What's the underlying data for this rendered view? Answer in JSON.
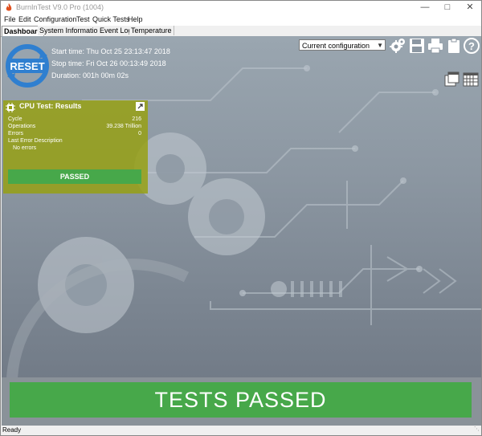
{
  "window": {
    "title": "BurnInTest V9.0 Pro (1004)",
    "controls": [
      "minimize",
      "maximize",
      "close"
    ]
  },
  "menu": [
    "File",
    "Edit",
    "Configuration",
    "Test",
    "Quick Tests",
    "Help"
  ],
  "tabs": [
    {
      "label": "Dashboard",
      "active": true
    },
    {
      "label": "System Information",
      "active": false
    },
    {
      "label": "Event Log",
      "active": false
    },
    {
      "label": "Temperature",
      "active": false
    }
  ],
  "reset_button": {
    "label": "RESET",
    "icon": "reset-arrows-icon"
  },
  "times": {
    "start": "Start time: Thu Oct 25 23:13:47 2018",
    "stop": "Stop time: Fri Oct 26 00:13:49 2018",
    "duration": "Duration: 001h 00m 02s"
  },
  "configuration": {
    "selected": "Current configuration"
  },
  "toolbar_icons": [
    "gears-icon",
    "save-icon",
    "printer-icon",
    "clipboard-icon",
    "help-icon"
  ],
  "view_icons": [
    "windows-view-icon",
    "grid-view-icon"
  ],
  "cpu_panel": {
    "title": "CPU Test: Results",
    "rows": [
      {
        "label": "Cycle",
        "value": "216"
      },
      {
        "label": "Operations",
        "value": "39.238 Trillion"
      },
      {
        "label": "Errors",
        "value": "0"
      },
      {
        "label": "Last Error Description",
        "value": ""
      }
    ],
    "error_text": "No errors",
    "result": "PASSED",
    "colors": {
      "panel": "#96a014",
      "passed": "#47a84a"
    }
  },
  "overall_result": "TESTS PASSED",
  "status": "Ready",
  "colors": {
    "accent_green": "#47a84a",
    "reset_blue": "#2f7fd0"
  }
}
